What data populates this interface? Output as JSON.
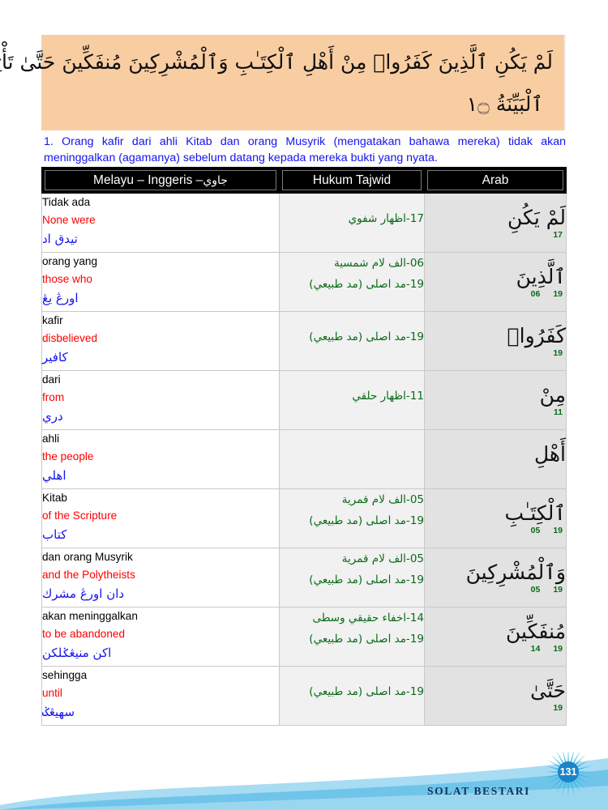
{
  "ayah": {
    "line1": "لَمْ يَكُنِ ٱلَّذِينَ كَفَرُوا۟ مِنْ أَهْلِ ٱلْكِتَـٰبِ وَٱلْمُشْرِكِينَ مُنفَكِّينَ حَتَّىٰ تَأْتِيَهُمُ",
    "line2": "ٱلْبَيِّنَةُ ۝١"
  },
  "translation": "1. Orang kafir dari ahli Kitab dan orang Musyrik (mengatakan bahawa mereka) tidak akan meninggalkan (agamanya) sebelum datang kepada mereka bukti yang nyata.",
  "table": {
    "headers": {
      "melayu": "Melayu – Inggeris –",
      "melayu_jawi": "جاوي",
      "tajwid": "Hukum Tajwid",
      "arab": "Arab"
    },
    "rows": [
      {
        "malay": "Tidak ada",
        "english": "None were",
        "jawi": "تيدق اد",
        "tajwid": [
          "17-اظهار شفوي"
        ],
        "arabic": "لَمْ يَكُنِ",
        "numbers": [
          "17"
        ]
      },
      {
        "malay": "orang yang",
        "english": "those who",
        "jawi": "اورڠ يڠ",
        "tajwid": [
          "06-الف لام شمسية",
          "19-مد اصلى (مد طبيعي)"
        ],
        "arabic": "ٱلَّذِينَ",
        "numbers": [
          "19",
          "06"
        ]
      },
      {
        "malay": "kafir",
        "english": "disbelieved",
        "jawi": "كافير",
        "tajwid": [
          "19-مد اصلى (مد طبيعي)"
        ],
        "arabic": "كَفَرُوا۟",
        "numbers": [
          "19"
        ]
      },
      {
        "malay": "dari",
        "english": "from",
        "jawi": "دري",
        "tajwid": [
          "11-اظهار حلقي"
        ],
        "arabic": "مِنْ",
        "numbers": [
          "11"
        ]
      },
      {
        "malay": "ahli",
        "english": "the people",
        "jawi": "اهلي",
        "tajwid": [],
        "arabic": "أَهْلِ",
        "numbers": []
      },
      {
        "malay": "Kitab",
        "english": "of the Scripture",
        "jawi": "كتاب",
        "tajwid": [
          "05-الف لام قمرية",
          "19-مد اصلى (مد طبيعي)"
        ],
        "arabic": "ٱلْكِتَـٰبِ",
        "numbers": [
          "19",
          "05"
        ]
      },
      {
        "malay": "dan orang Musyrik",
        "english": "and the Polytheists",
        "jawi": "دان اورڠ مشرك",
        "tajwid": [
          "05-الف لام قمرية",
          "19-مد اصلى (مد طبيعي)"
        ],
        "arabic": "وَٱلْمُشْرِكِينَ",
        "numbers": [
          "19",
          "05"
        ]
      },
      {
        "malay": "akan meninggalkan",
        "english": "to be abandoned",
        "jawi": "اكن منيڠݢلكن",
        "tajwid": [
          "14-اخفاء حقيقي وسطى",
          "19-مد اصلى (مد طبيعي)"
        ],
        "arabic": "مُنفَكِّينَ",
        "numbers": [
          "19",
          "14"
        ]
      },
      {
        "malay": "sehingga",
        "english": "until",
        "jawi": "سهيڠݢ",
        "tajwid": [
          "19-مد اصلى (مد طبيعي)"
        ],
        "arabic": "حَتَّىٰ",
        "numbers": [
          "19"
        ]
      }
    ]
  },
  "footer": {
    "label": "SOLAT BESTARI",
    "page_number": "131"
  },
  "colors": {
    "ayah_background": "#F9CDA2",
    "translation_text": "#1313EE",
    "english_text": "#FF0000",
    "jawi_text": "#1313EE",
    "tajwid_text": "#0A6B18",
    "header_background": "#000000",
    "footer_blue": "#66C4E8"
  }
}
